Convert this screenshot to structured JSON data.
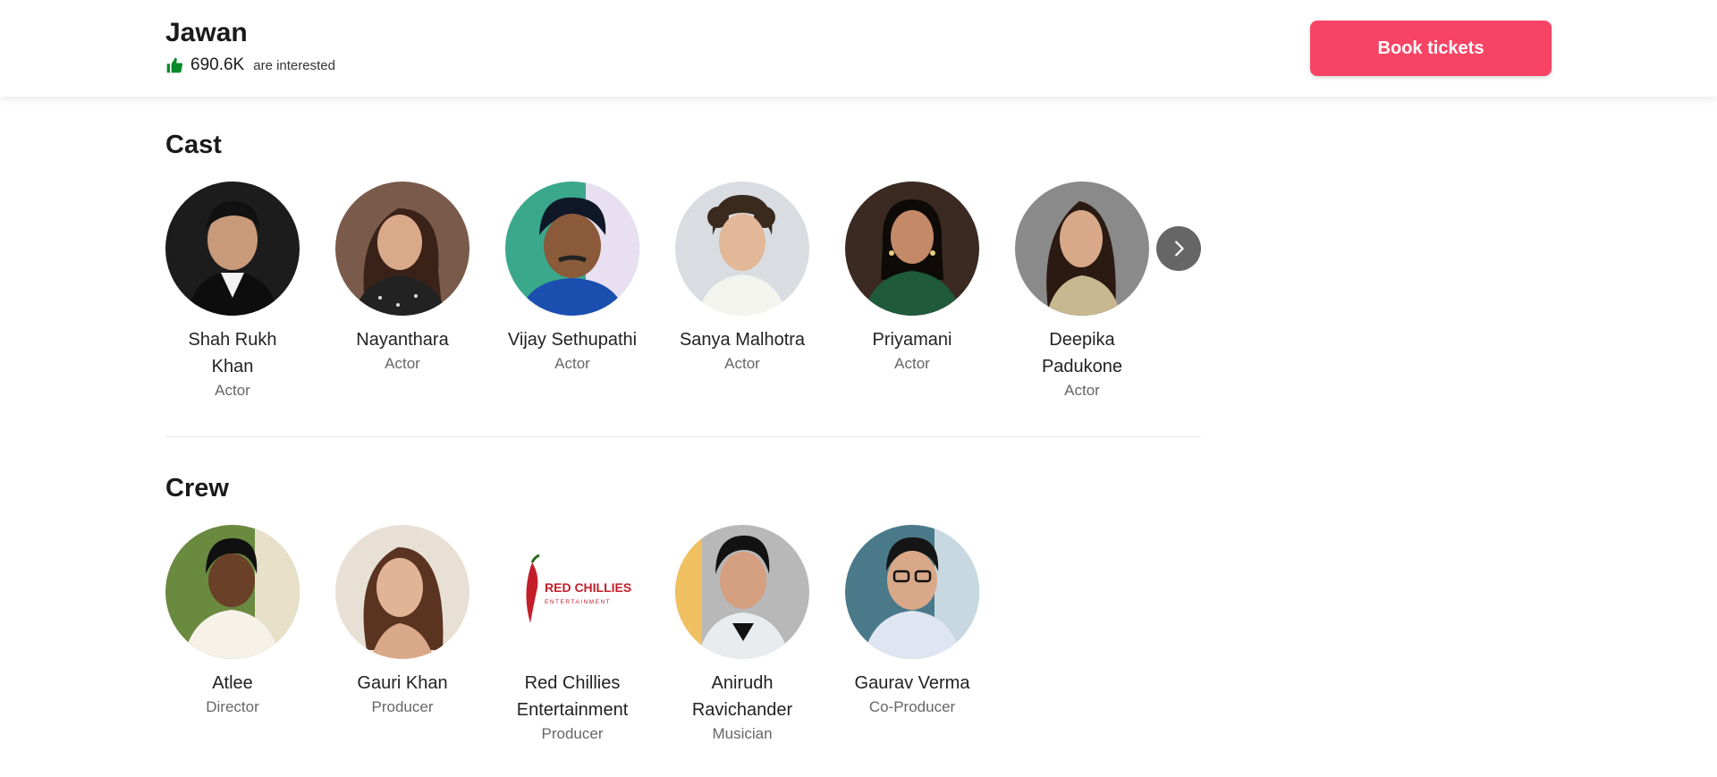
{
  "header": {
    "title": "Jawan",
    "interest_count": "690.6K",
    "interest_label": "are interested",
    "book_label": "Book tickets"
  },
  "colors": {
    "accent": "#f84464",
    "thumb": "#0b8a2c",
    "next_button": "#666666"
  },
  "cast": {
    "title": "Cast",
    "members": [
      {
        "name": "Shah Rukh Khan",
        "role": "Actor"
      },
      {
        "name": "Nayanthara",
        "role": "Actor"
      },
      {
        "name": "Vijay Sethupathi",
        "role": "Actor"
      },
      {
        "name": "Sanya Malhotra",
        "role": "Actor"
      },
      {
        "name": "Priyamani",
        "role": "Actor"
      },
      {
        "name": "Deepika Padukone",
        "role": "Actor"
      }
    ],
    "next_icon": "chevron-right-icon"
  },
  "crew": {
    "title": "Crew",
    "members": [
      {
        "name": "Atlee",
        "role": "Director"
      },
      {
        "name": "Gauri Khan",
        "role": "Producer"
      },
      {
        "name": "Red Chillies Entertainment",
        "role": "Producer"
      },
      {
        "name": "Anirudh Ravichander",
        "role": "Musician"
      },
      {
        "name": "Gaurav Verma",
        "role": "Co-Producer"
      }
    ]
  },
  "logo_text": {
    "line1": "RED CHILLIES",
    "line2": "ENTERTAINMENT"
  }
}
